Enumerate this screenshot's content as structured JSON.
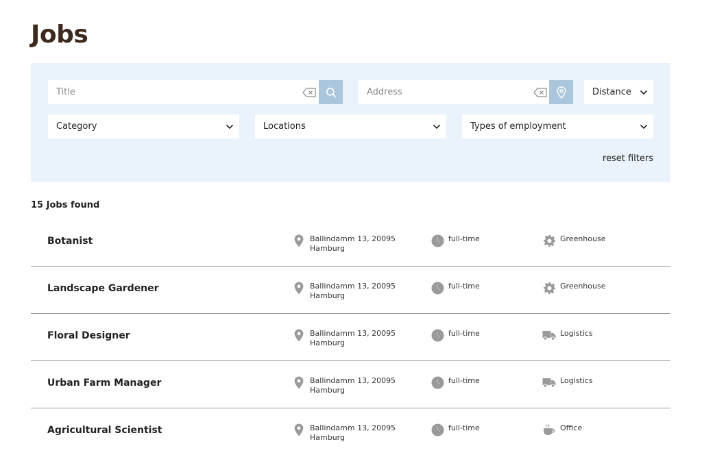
{
  "page": {
    "title": "Jobs"
  },
  "filters": {
    "title_placeholder": "Title",
    "address_placeholder": "Address",
    "distance_label": "Distance",
    "category_label": "Category",
    "locations_label": "Locations",
    "employment_label": "Types of employment",
    "reset_label": "reset filters"
  },
  "results": {
    "count_text": "15 Jobs found"
  },
  "jobs": [
    {
      "title": "Botanist",
      "address": "Ballindamm 13, 20095 Hamburg",
      "type": "full-time",
      "category": "Greenhouse",
      "category_icon": "gear-icon"
    },
    {
      "title": "Landscape Gardener",
      "address": "Ballindamm 13, 20095 Hamburg",
      "type": "full-time",
      "category": "Greenhouse",
      "category_icon": "gear-icon"
    },
    {
      "title": "Floral Designer",
      "address": "Ballindamm 13, 20095 Hamburg",
      "type": "full-time",
      "category": "Logistics",
      "category_icon": "truck-icon"
    },
    {
      "title": "Urban Farm Manager",
      "address": "Ballindamm 13, 20095 Hamburg",
      "type": "full-time",
      "category": "Logistics",
      "category_icon": "truck-icon"
    },
    {
      "title": "Agricultural Scientist",
      "address": "Ballindamm 13, 20095 Hamburg",
      "type": "full-time",
      "category": "Office",
      "category_icon": "coffee-cup-icon"
    }
  ],
  "colors": {
    "panel": "#eaf3fb",
    "button": "#a9c6dc",
    "title": "#3d2a1c",
    "icon": "#999999"
  }
}
